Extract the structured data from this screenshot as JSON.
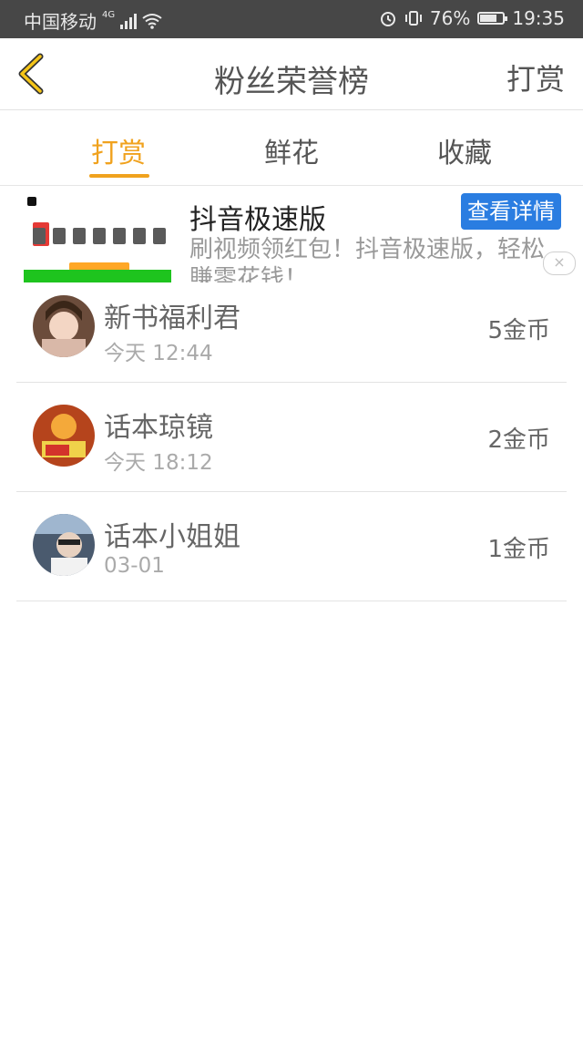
{
  "status": {
    "carrier": "中国移动",
    "network": "4G",
    "battery": "76%",
    "battery_level": 0.76,
    "time": "19:35"
  },
  "header": {
    "title": "粉丝荣誉榜",
    "right_action": "打赏"
  },
  "tabs": [
    {
      "label": "打赏",
      "active": true
    },
    {
      "label": "鲜花",
      "active": false
    },
    {
      "label": "收藏",
      "active": false
    }
  ],
  "ad": {
    "title": "抖音极速版",
    "description": "刷视频领红包！抖音极速版，轻松賺零花钱！",
    "button": "查看详情",
    "close": "×"
  },
  "list": [
    {
      "name": "新书福利君",
      "time": "今天 12:44",
      "coins": "5金币"
    },
    {
      "name": "话本琼镜",
      "time": "今天 18:12",
      "coins": "2金币"
    },
    {
      "name": "话本小姐姐",
      "time": "03-01",
      "coins": "1金币"
    }
  ],
  "colors": {
    "accent": "#f0a21e",
    "ad_button": "#2a7de1",
    "status_bar": "#474747"
  }
}
